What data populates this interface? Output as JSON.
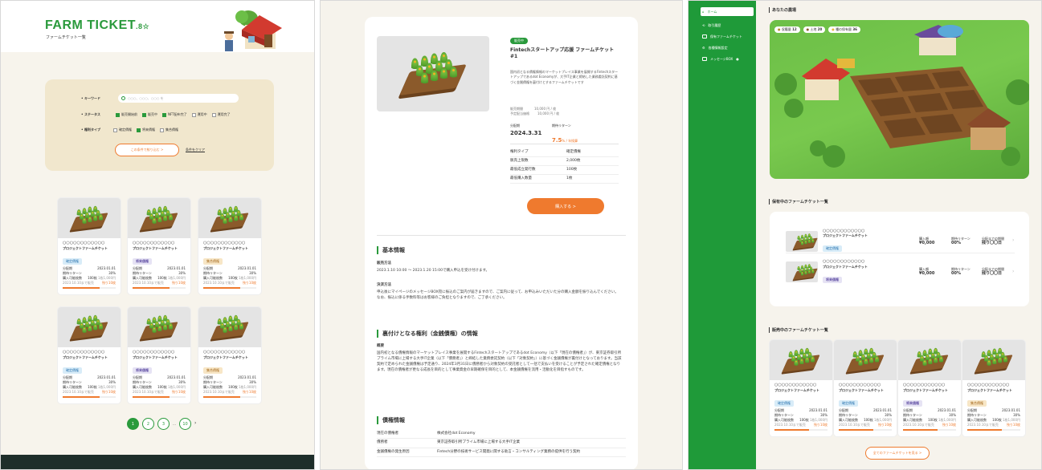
{
  "panel1": {
    "logo": "FARM TICKET",
    "logo_mark": ".8☆",
    "subtitle": "ファームチケット一覧",
    "search": {
      "keyword_label": "キーワード",
      "keyword_placeholder": "○○○、○○○、○○○ を",
      "status_label": "ステータス",
      "status_options": [
        "販売開始前",
        "販売中",
        "NFT配布完了",
        "運用中",
        "運用完了"
      ],
      "rights_label": "権利タイプ",
      "rights_options": [
        "確定債権",
        "将来債権",
        "集合債権"
      ],
      "submit": "この条件で絞り込む >",
      "clear": "条件をクリア"
    },
    "cards": [
      {
        "title": "○○○○○○○○○○○○",
        "sub": "プロジェクトファームチケット",
        "tag": "確定債権",
        "tag_class": "g",
        "date": "2023.01.01",
        "rate": "30%",
        "limit": "100枚",
        "note": "2023.10.10まで販売",
        "remain": "残り10枚",
        "progress": 0.7
      },
      {
        "title": "○○○○○○○○○○○○",
        "sub": "プロジェクトファームチケット",
        "tag": "将来債権",
        "tag_class": "b",
        "date": "2023.01.01",
        "rate": "30%",
        "limit": "100枚",
        "note": "2023.10.10まで販売",
        "remain": "残り10枚",
        "progress": 0.7
      },
      {
        "title": "○○○○○○○○○○○○",
        "sub": "プロジェクトファームチケット",
        "tag": "集合債権",
        "tag_class": "y",
        "date": "2023.01.01",
        "rate": "30%",
        "limit": "100枚",
        "note": "2023.10.10まで販売",
        "remain": "残り10枚",
        "progress": 0.7
      },
      {
        "title": "○○○○○○○○○○○○",
        "sub": "プロジェクトファームチケット",
        "tag": "確定債権",
        "tag_class": "g",
        "date": "2023.01.01",
        "rate": "30%",
        "limit": "100枚",
        "note": "2023.10.10まで販売",
        "remain": "残り10枚",
        "progress": 0.7
      },
      {
        "title": "○○○○○○○○○○○○",
        "sub": "プロジェクトファームチケット",
        "tag": "将来債権",
        "tag_class": "b",
        "date": "2023.01.01",
        "rate": "30%",
        "limit": "100枚",
        "note": "2023.10.10まで販売",
        "remain": "残り10枚",
        "progress": 0.7
      },
      {
        "title": "○○○○○○○○○○○○",
        "sub": "プロジェクトファームチケット",
        "tag": "集合債権",
        "tag_class": "y",
        "date": "2023.01.01",
        "rate": "30%",
        "limit": "100枚",
        "note": "2023.10.10まで販売",
        "remain": "残り10枚",
        "progress": 0.7
      }
    ],
    "card_labels": {
      "date": "分配期",
      "rate": "期待リターン",
      "limit": "購入可能枚数",
      "per": "1枚1,000円"
    },
    "pager": [
      "1",
      "2",
      "3",
      "…",
      "10",
      "›"
    ]
  },
  "panel2": {
    "badge": "販売中",
    "title": "Fintechスタートアップ応援 ファームチケット #1",
    "desc": "国内初となる債権情報のマーケットプレイス事業を展開するFintechスタートアップであるdot Economyが、大手IT企業と締結した業務委託契約に基づく金銭債権を裏付けとするファームチケットです",
    "meta": [
      {
        "k": "販売期間",
        "v": "10,000 円 / 枚"
      },
      {
        "k": "予定配当価格",
        "v": "10,000 円 / 枚"
      }
    ],
    "period_label": "分配期",
    "period": "2024.3.31",
    "return_label": "期待リターン",
    "return": "7.5",
    "return_unit": "% / 年換算",
    "spec": [
      {
        "k": "権利タイプ",
        "v": "確定債権"
      },
      {
        "k": "販売上限数",
        "v": "2,000枚"
      },
      {
        "k": "最低成立発行数",
        "v": "100枚"
      },
      {
        "k": "最低購入数量",
        "v": "1枚"
      }
    ],
    "buy": "購入する >",
    "s1": "基本情報",
    "sales_h": "販売方法",
    "sales_t": "2023.1.10 10:00 〜 2023.1.20 15:00で購入申込を受け付けます。",
    "pay_h": "決済方法",
    "pay_t": "申込後にマイページのメッセージBOX宛に振込のご案内が届きますので、ご案内に従って、お申込みいただいた分の購入金額を振り込んでください。なお、振込に係る手数料等はお客様のご負担となりますので、ご了承ください。",
    "s2": "裏付けとなる権利（金銭債権）の情報",
    "ov_h": "概要",
    "ov_t": "国内初となる債権情報のマーケットプレイス事業を展開するFintechスタートアップであるdot Economy（以下「現在の債権者」）が、東京証券取引所プライム市場に上場する大手IT企業（以下「債務者」）と締結した業務委託契約（以下「対象契約」）に基づく金銭債権が裏付けとなっております。当該契約で定められた金銭債権は予定通り、2024年3月31日に債務者から対象契約の受託者として一括で支払いを受けることが予定された確定債権となります。現在の債権者が更なる成長を目的として事業資金の早期確保を目的として、本金銭債権を流用・活動化を目指すものです。",
    "s3": "債権情報",
    "info": [
      {
        "k": "現在の債権者",
        "v": "株式会社dot Economy"
      },
      {
        "k": "債務者",
        "v": "東京証券取引所プライム市場に上場する大手IT企業"
      },
      {
        "k": "金銭債権の発生原因",
        "v": "Fintech分野の技術サービス開発に関する助言・コンサルティング業務の提供を行う契約"
      }
    ]
  },
  "panel3": {
    "nav": [
      "ホーム",
      "取引履歴",
      "保有ファームチケット",
      "各種情報設定",
      "メッセージBOX"
    ],
    "farm_title": "あなたの農場",
    "chips": [
      {
        "label": "収穫量",
        "val": "12"
      },
      {
        "label": "土地",
        "val": "20"
      },
      {
        "label": "種の保有量",
        "val": "36"
      }
    ],
    "owned_title": "保有中のファームチケット一覧",
    "owned": [
      {
        "title": "○○○○○○○○○○○○",
        "sub": "プロジェクトファームチケット",
        "tag": "確定債権",
        "tag_class": "g",
        "price_label": "購入額",
        "price": "¥0,000",
        "ret_label": "期待リターン",
        "ret": "00%",
        "end_label": "分配までの期間",
        "end": "残り〇〇日"
      },
      {
        "title": "○○○○○○○○○○○○",
        "sub": "プロジェクトファームチケット",
        "tag": "将来債権",
        "tag_class": "b",
        "price_label": "購入額",
        "price": "¥0,000",
        "ret_label": "期待リターン",
        "ret": "00%",
        "end_label": "分配までの期間",
        "end": "残り〇〇日"
      }
    ],
    "sale_title": "販売中のファームチケット一覧",
    "sale": [
      {
        "title": "○○○○○○○○○○○○",
        "sub": "プロジェクトファームチケット",
        "tag": "確定債権",
        "tag_class": "g",
        "date": "2023.01.01",
        "rate": "30%",
        "limit": "100枚",
        "note": "2023.10.10まで販売",
        "remain": "残り10枚",
        "progress": 0.65
      },
      {
        "title": "○○○○○○○○○○○○",
        "sub": "プロジェクトファームチケット",
        "tag": "確定債権",
        "tag_class": "g",
        "date": "2023.01.01",
        "rate": "30%",
        "limit": "100枚",
        "note": "2023.10.10まで販売",
        "remain": "残り10枚",
        "progress": 0.65
      },
      {
        "title": "○○○○○○○○○○○○",
        "sub": "プロジェクトファームチケット",
        "tag": "将来債権",
        "tag_class": "b",
        "date": "2023.01.01",
        "rate": "30%",
        "limit": "100枚",
        "note": "2023.10.10まで販売",
        "remain": "残り10枚",
        "progress": 0.65
      },
      {
        "title": "○○○○○○○○○○○○",
        "sub": "プロジェクトファームチケット",
        "tag": "集合債権",
        "tag_class": "y",
        "date": "2023.01.01",
        "rate": "30%",
        "limit": "100枚",
        "note": "2023.10.10まで販売",
        "remain": "残り10枚",
        "progress": 0.65
      }
    ],
    "see_all": "全てのファームチケットを見る >"
  },
  "colors": {
    "green": "#2a9a3c",
    "orange": "#ef7a2e",
    "sidebar": "#1f9a39"
  }
}
